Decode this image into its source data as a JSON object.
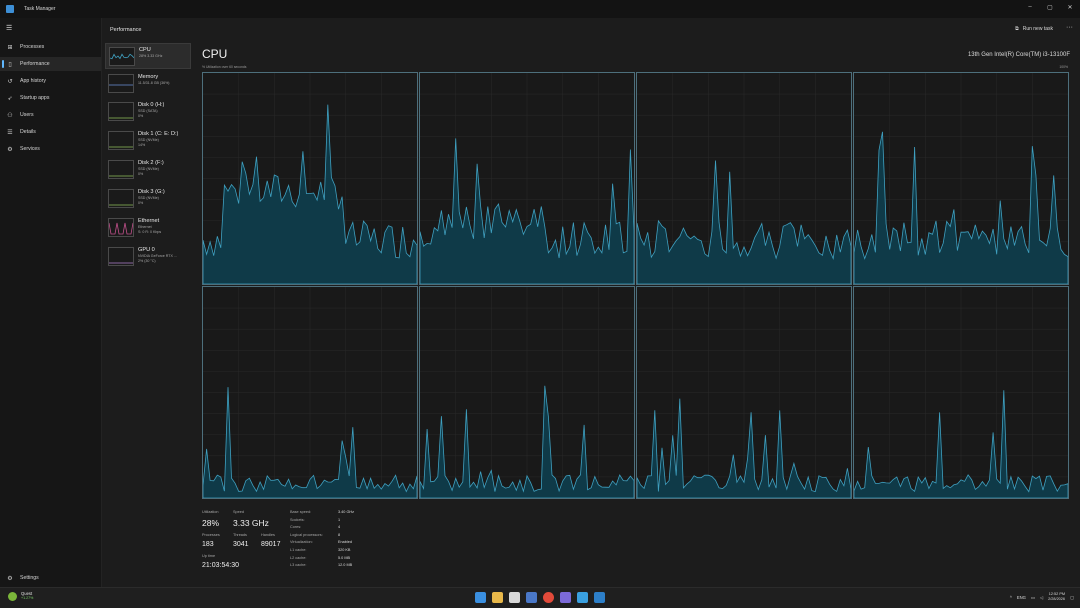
{
  "window": {
    "title": "Task Manager",
    "minimize": "–",
    "maximize": "▢",
    "close": "✕"
  },
  "nav": {
    "menu_icon": "hamburger-icon",
    "items": [
      {
        "label": "Processes",
        "icon": "processes-icon",
        "glyph": "⊞"
      },
      {
        "label": "Performance",
        "icon": "performance-icon",
        "glyph": "▯",
        "active": true
      },
      {
        "label": "App history",
        "icon": "app-history-icon",
        "glyph": "↺"
      },
      {
        "label": "Startup apps",
        "icon": "startup-icon",
        "glyph": "➶"
      },
      {
        "label": "Users",
        "icon": "users-icon",
        "glyph": "⚇"
      },
      {
        "label": "Details",
        "icon": "details-icon",
        "glyph": "☰"
      },
      {
        "label": "Services",
        "icon": "services-icon",
        "glyph": "⚙"
      }
    ],
    "settings_label": "Settings",
    "settings_glyph": "⚙"
  },
  "header": {
    "title": "Performance",
    "run_task": "Run new task",
    "more": "···"
  },
  "resources": [
    {
      "name": "CPU",
      "sub1": "28% 3.33 GHz",
      "sub2": "",
      "color": "#3fa0c0",
      "active": true
    },
    {
      "name": "Memory",
      "sub1": "11.5/31.8 GB (36%)",
      "sub2": "",
      "color": "#6a8fd8"
    },
    {
      "name": "Disk 0 (H:)",
      "sub1": "SSD (SATA)",
      "sub2": "0%",
      "color": "#8fbf5a"
    },
    {
      "name": "Disk 1 (C: E: D:)",
      "sub1": "SSD (NVMe)",
      "sub2": "14%",
      "color": "#8fbf5a"
    },
    {
      "name": "Disk 2 (F:)",
      "sub1": "SSD (NVMe)",
      "sub2": "0%",
      "color": "#8fbf5a"
    },
    {
      "name": "Disk 3 (G:)",
      "sub1": "SSD (NVMe)",
      "sub2": "0%",
      "color": "#8fbf5a"
    },
    {
      "name": "Ethernet",
      "sub1": "Ethernet",
      "sub2": "S: 0 R: 0 Kbps",
      "color": "#c0508a"
    },
    {
      "name": "GPU 0",
      "sub1": "NVIDIA GeForce RTX ...",
      "sub2": "2% (30 °C)",
      "color": "#b07fd0"
    }
  ],
  "cpu": {
    "title": "CPU",
    "model": "13th Gen Intel(R) Core(TM) i3-13100F",
    "util_label": "% Utilization over 60 seconds",
    "util_max": "100%"
  },
  "stats": {
    "utilization_label": "Utilization",
    "utilization": "28%",
    "speed_label": "Speed",
    "speed": "3.33 GHz",
    "processes_label": "Processes",
    "processes": "183",
    "threads_label": "Threads",
    "threads": "3041",
    "handles_label": "Handles",
    "handles": "89017",
    "uptime_label": "Up time",
    "uptime": "21:03:54:30"
  },
  "specs": [
    {
      "key": "Base speed:",
      "value": "3.40 GHz"
    },
    {
      "key": "Sockets:",
      "value": "1"
    },
    {
      "key": "Cores:",
      "value": "4"
    },
    {
      "key": "Logical processors:",
      "value": "8"
    },
    {
      "key": "Virtualization:",
      "value": "Enabled"
    },
    {
      "key": "L1 cache:",
      "value": "320 KB"
    },
    {
      "key": "L2 cache:",
      "value": "5.0 MB"
    },
    {
      "key": "L3 cache:",
      "value": "12.0 MB"
    }
  ],
  "taskbar": {
    "weather_title": "Quest",
    "weather_sub": "+1.27%",
    "tray_lang": "ENG",
    "tray_up": "^",
    "time": "12:52 PM",
    "date": "2/28/2026"
  },
  "colors": {
    "accent": "#60b8ff",
    "cpu_line": "#3fa0c0",
    "cpu_fill": "#0f3a48",
    "grid": "#2a2a2a"
  }
}
